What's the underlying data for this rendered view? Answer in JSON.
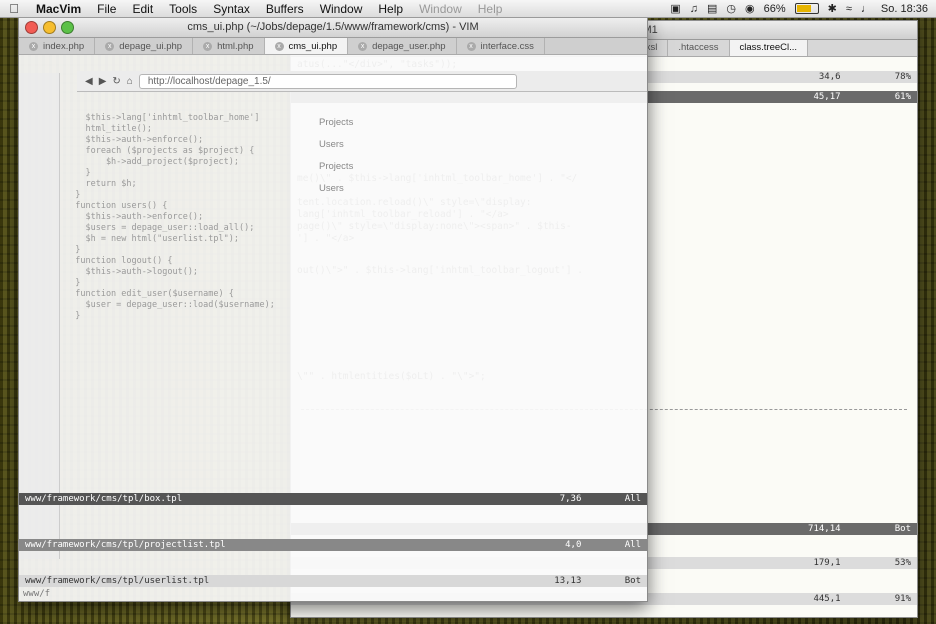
{
  "menubar": {
    "app_name": "MacVim",
    "items": [
      "File",
      "Edit",
      "Tools",
      "Syntax",
      "Buffers",
      "Window",
      "Help"
    ],
    "ghost_items": [
      "Window",
      "Help"
    ],
    "status": {
      "battery_percent": "66%",
      "clock": "So. 18:36"
    },
    "battery_level": 0.66
  },
  "back_window": {
    "title": "/framework/lib) - VIM1",
    "tabs": [
      "atom.xsl",
      ".htaccess",
      "class.treeCl..."
    ],
    "top_code": "atus(...\"</div>\", \"tasks\"));",
    "status_1": {
      "pos": "34,6",
      "pct": "78%"
    },
    "status_2": {
      "pos": "45,17",
      "pct": "61%"
    },
    "code_lines": [
      "me()\\\" . $this->lang['inhtml_toolbar_home'] . \"</",
      "tent.location.reload()\\\" style=\\\"display:",
      "lang['inhtml_toolbar_reload'] . \"</a>",
      "page()\\\" style=\\\"display:none\\\"><span>\" . $this-",
      "'] . \"</a>",
      "out()\\\">\" . $this->lang['inhtml_toolbar_logout'] .",
      "\\\"\" . htmlentities($oLt) . \"\\\">\";"
    ],
    "status_3": {
      "pos": "714,14",
      "pct": "Bot"
    },
    "status_4": {
      "pos": "179,1",
      "pct": "53%"
    },
    "status_5": {
      "pos": "445,1",
      "pct": "91%"
    }
  },
  "front_window": {
    "title": "cms_ui.php (~/Jobs/depage/1.5/www/framework/cms) - VIM",
    "tabs": [
      "index.php",
      "depage_ui.php",
      "html.php",
      "cms_ui.php",
      "depage_user.php",
      "interface.css"
    ],
    "active_tab_index": 3,
    "browser": {
      "url": "http://localhost/depage_1.5/"
    },
    "sidebar_ghost": [
      "Projects",
      "Users",
      "Projects",
      "Users"
    ],
    "code_lines": [
      "    $this->lang['inhtml_toolbar_home']",
      "    html_title();",
      "    $this->auth->enforce();",
      "    foreach ($projects as $project) {",
      "        $h->add_project($project);",
      "    }",
      "    return $h;",
      "  }",
      "  function users() {",
      "    $this->auth->enforce();",
      "    $users = depage_user::load_all();",
      "    $h = new html(\"userlist.tpl\");",
      "  }",
      "  function logout() {",
      "    $this->auth->logout();",
      "  }",
      "  function edit_user($username) {",
      "    $user = depage_user::load($username);",
      "  }"
    ],
    "status_lines": [
      {
        "file": "www/framework/cms/tpl/box.tpl",
        "pos": "7,36",
        "pct": "All"
      },
      {
        "file": "www/framework/cms/tpl/projectlist.tpl",
        "pos": "4,0",
        "pct": "All"
      },
      {
        "file": "www/framework/cms/tpl/userlist.tpl",
        "pos": "13,13",
        "pct": "Bot"
      }
    ],
    "bottom_text": "www/f"
  }
}
